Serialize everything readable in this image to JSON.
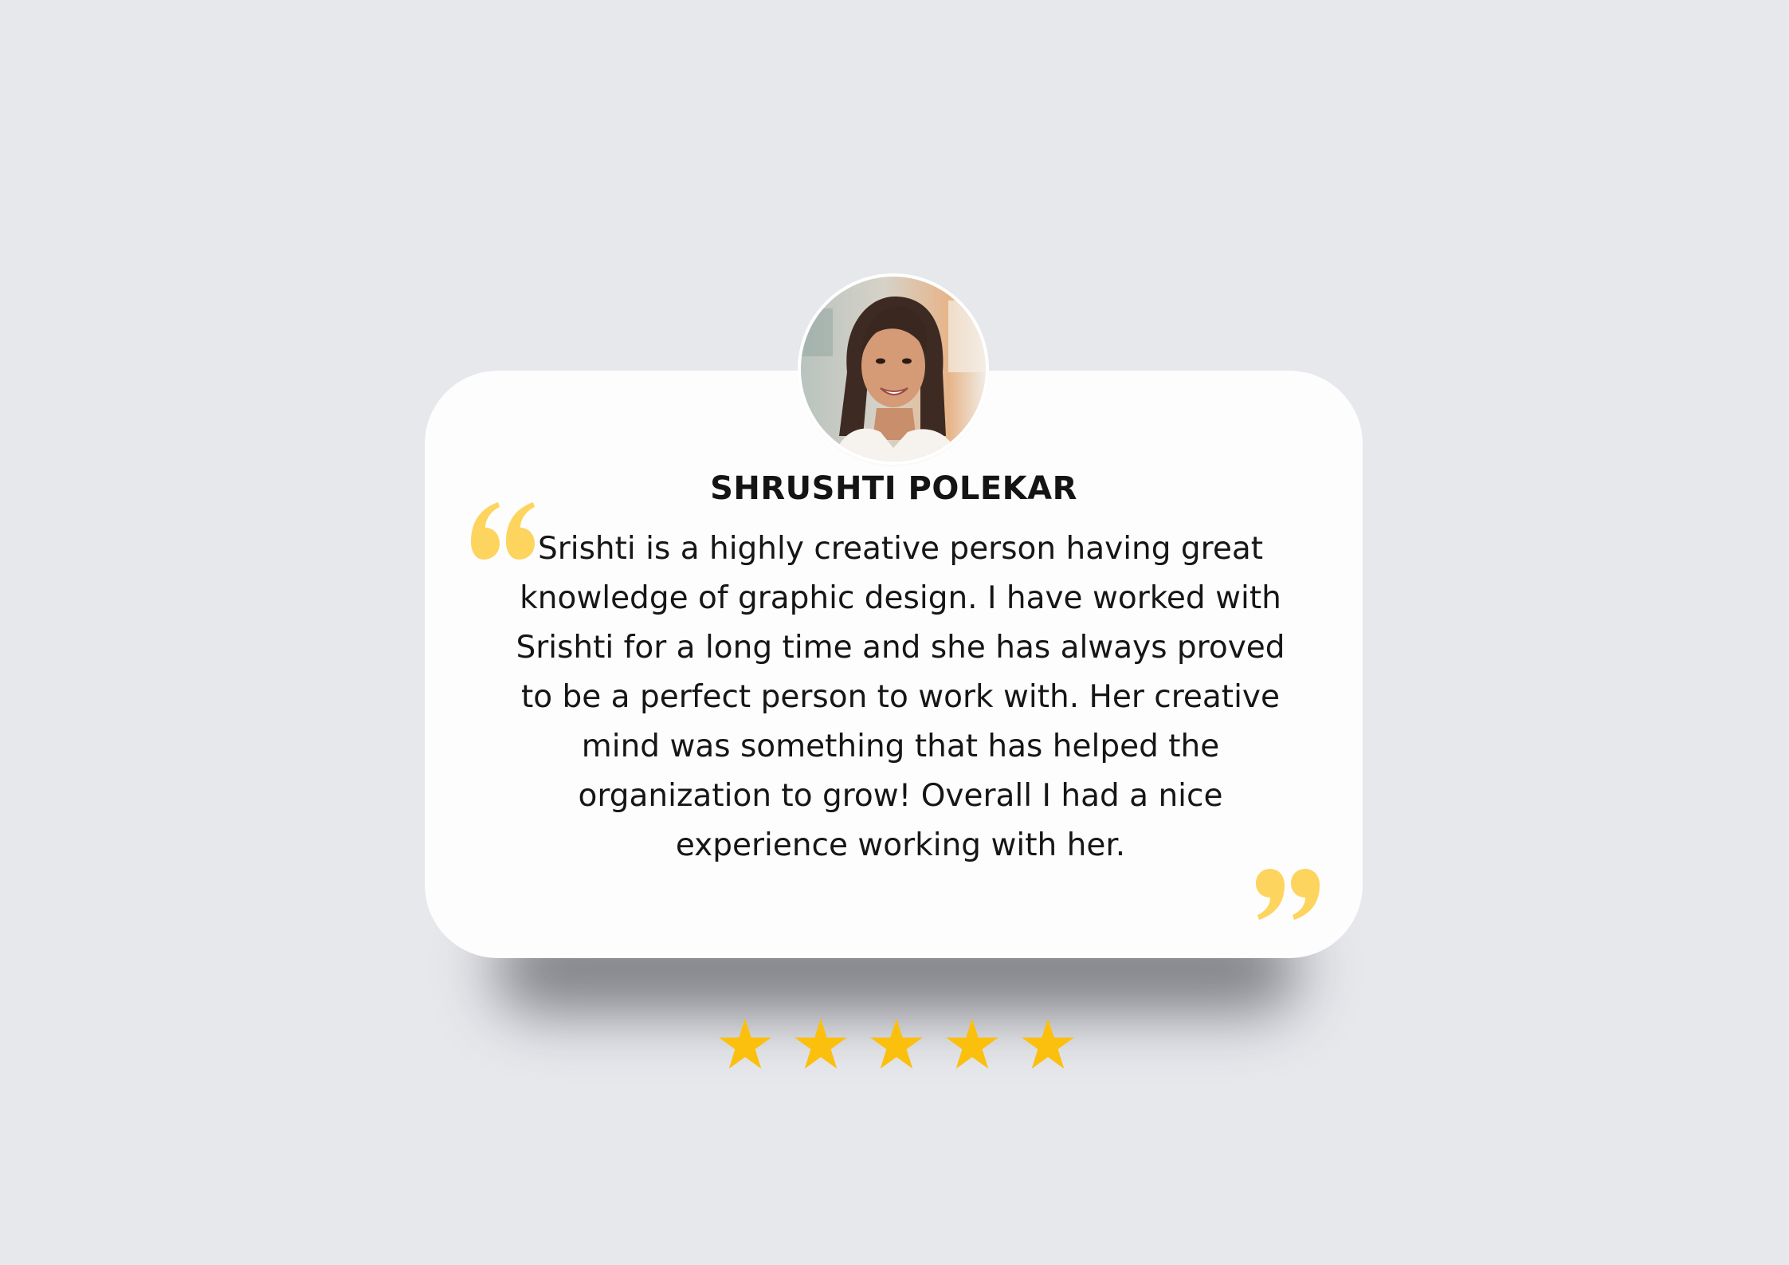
{
  "testimonial": {
    "name": "SHRUSHTI POLEKAR",
    "text": "Srishti is a highly creative person having great knowledge of graphic design. I have worked with Srishti for a long time and she has always proved to be a perfect person to work with. Her creative mind was something that has helped the organization to grow! Overall I had a nice experience working with her.",
    "rating": 5,
    "rating_max": 5
  },
  "icons": {
    "avatar": "person-photo",
    "open_quote": "open-quote-icon",
    "close_quote": "close-quote-icon",
    "star": "star-icon"
  },
  "colors": {
    "background": "#e7e8ec",
    "card": "#fdfdfd",
    "quote_marks": "#fdd45e",
    "stars": "#fbbf0e",
    "text": "#161616"
  }
}
